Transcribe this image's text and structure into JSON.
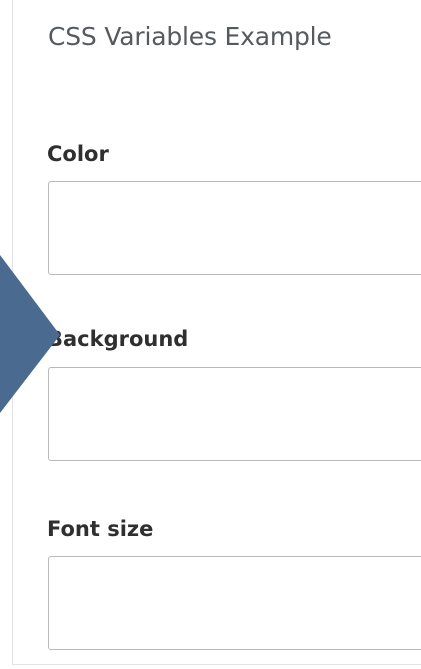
{
  "panel": {
    "title": "CSS Variables Example"
  },
  "fields": [
    {
      "label": "Color",
      "value": ""
    },
    {
      "label": "Background",
      "value": ""
    },
    {
      "label": "Font size",
      "value": ""
    }
  ],
  "colors": {
    "arrow": "#4a6b8f",
    "panel_border": "#e3e3e3",
    "input_border": "#b9b9b9",
    "title_text": "#555a5e",
    "label_text": "#2f2f2f"
  },
  "icons": {
    "pointer": "right-arrow-icon"
  }
}
